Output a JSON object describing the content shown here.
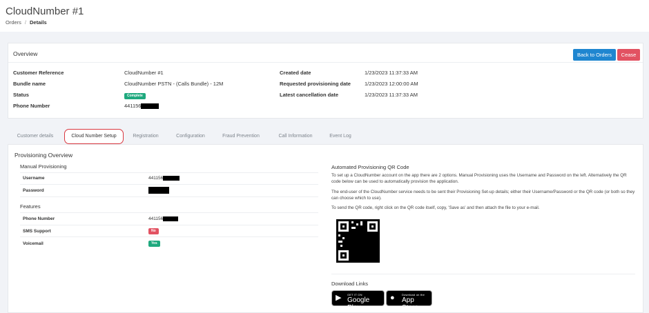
{
  "header": {
    "title": "CloudNumber #1",
    "breadcrumb": {
      "root": "Orders",
      "separator": "/",
      "current": "Details"
    }
  },
  "overview": {
    "title": "Overview",
    "back_label": "Back to Orders",
    "cease_label": "Cease",
    "left_fields": [
      {
        "label": "Customer Reference",
        "value": "CloudNumber #1"
      },
      {
        "label": "Bundle name",
        "value": "CloudNumber PSTN - (Calls Bundle) - 12M"
      },
      {
        "label": "Status",
        "badge": "Complete"
      },
      {
        "label": "Phone Number",
        "value": "441156"
      }
    ],
    "right_fields": [
      {
        "label": "Created date",
        "value": "1/23/2023 11:37:33 AM"
      },
      {
        "label": "Requested provisioning date",
        "value": "1/23/2023 12:00:00 AM"
      },
      {
        "label": "Latest cancellation date",
        "value": "1/23/2023 11:37:33 AM"
      }
    ]
  },
  "tabs": [
    {
      "label": "Customer details"
    },
    {
      "label": "Cloud Number Setup",
      "active": true
    },
    {
      "label": "Registration"
    },
    {
      "label": "Configuration"
    },
    {
      "label": "Fraud Prevention"
    },
    {
      "label": "Call Information"
    },
    {
      "label": "Event Log"
    }
  ],
  "provisioning": {
    "title": "Provisioning Overview",
    "manual": {
      "title": "Manual Provisioning",
      "rows": [
        {
          "label": "Username",
          "value": "441156"
        },
        {
          "label": "Password",
          "value": ""
        }
      ]
    },
    "features": {
      "title": "Features",
      "rows": [
        {
          "label": "Phone Number",
          "value": "441156"
        },
        {
          "label": "SMS Support",
          "badge": "No"
        },
        {
          "label": "Voicemail",
          "badge": "Yes"
        }
      ]
    }
  },
  "qr_section": {
    "title": "Automated Provisioning QR Code",
    "paragraphs": [
      "To set up a CloudNumber account on the app there are 2 options. Manual Provisioning uses the Username and Password on the left. Alternatively the QR code below can be used to automatically provision the application.",
      "The end-user of the CloudNumber service needs to be sent their Provisioning Set-up details; either their Username/Password or the QR code (or both so they can choose which to use).",
      "To send the QR code, right click on the QR code itself, copy, 'Save as' and then attach the file to your e-mail."
    ],
    "download_title": "Download Links",
    "google_play": {
      "small": "GET IT ON",
      "large": "Google Play"
    },
    "app_store": {
      "small": "Download on the",
      "large": "App Store"
    }
  },
  "colors": {
    "primary": "#1f86d0",
    "danger": "#e25262",
    "success": "#1fa97e",
    "highlight": "#d9363e"
  }
}
